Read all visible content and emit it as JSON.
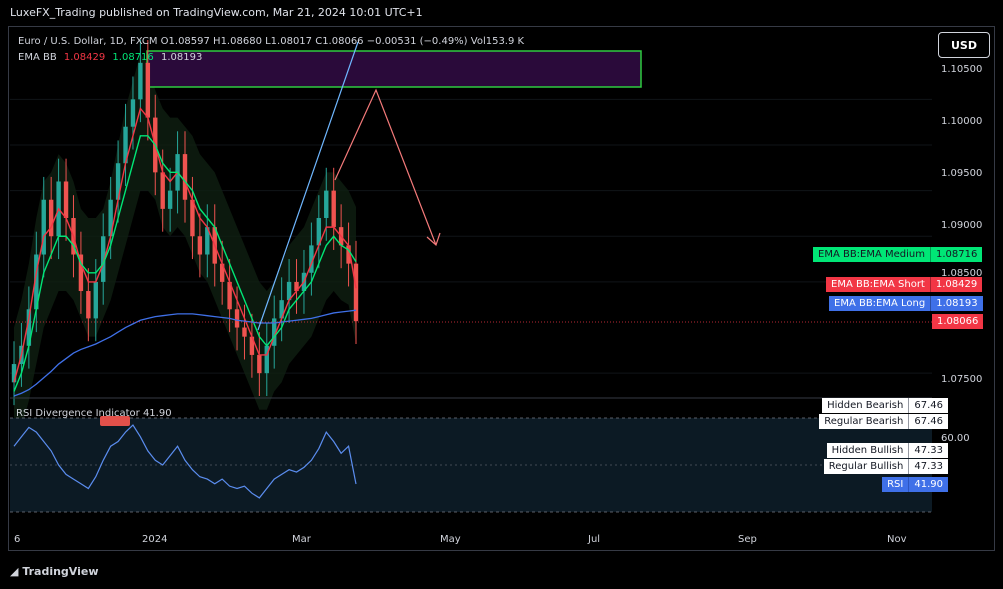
{
  "header": {
    "published": "LuxeFX_Trading published on TradingView.com, Mar 21, 2024 10:01 UTC+1",
    "symbol_line": "Euro / U.S. Dollar, 1D, FXCM  O1.08597  H1.08680  L1.08017  C1.08066  −0.00531 (−0.49%)  Vol153.9 K",
    "ema_label": "EMA BB",
    "ema_values": [
      "1.08429",
      "1.08716",
      "1.08193"
    ],
    "currency_button": "USD"
  },
  "colors": {
    "ema_short": "#f23645",
    "ema_medium": "#00e676",
    "ema_long": "#3f70e8",
    "bull": "#26a69a",
    "bear": "#ef5350",
    "rsi": "#5b8def",
    "zone": "#2a0a3a",
    "zone_border": "#2ecc40",
    "projection": "#f47a7a",
    "trendline": "#6fb7ff"
  },
  "price_tags": [
    {
      "name": "EMA BB:EMA Medium",
      "value": "1.08716",
      "bg": "#00e676",
      "fg": "#131722"
    },
    {
      "name": "EMA BB:EMA Short",
      "value": "1.08429",
      "bg": "#f23645",
      "fg": "#ffffff"
    },
    {
      "name": "EMA BB:EMA Long",
      "value": "1.08193",
      "bg": "#3f70e8",
      "fg": "#ffffff"
    },
    {
      "name": "",
      "value": "1.08066",
      "bg": "#f23645",
      "fg": "#ffffff"
    }
  ],
  "rsi": {
    "title": "RSI Divergence Indicator  41.90",
    "tags": [
      {
        "name": "Hidden Bearish",
        "value": "67.46"
      },
      {
        "name": "Regular Bearish",
        "value": "67.46"
      },
      {
        "name": "Hidden Bullish",
        "value": "47.33"
      },
      {
        "name": "Regular Bullish",
        "value": "47.33"
      },
      {
        "name": "RSI",
        "value": "41.90"
      }
    ],
    "level_label": "60.00"
  },
  "footer": {
    "brand": "TradingView"
  },
  "chart_data": {
    "type": "line",
    "y_ticks": [
      "1.10500",
      "1.10000",
      "1.09500",
      "1.09000",
      "1.08500",
      "1.07500"
    ],
    "x_ticks": [
      "6",
      "2024",
      "Mar",
      "May",
      "Jul",
      "Sep",
      "Nov"
    ],
    "ylim": [
      1.0725,
      1.1115
    ],
    "candles_close": [
      1.076,
      1.078,
      1.082,
      1.088,
      1.094,
      1.09,
      1.096,
      1.092,
      1.088,
      1.084,
      1.081,
      1.085,
      1.09,
      1.094,
      1.098,
      1.102,
      1.105,
      1.109,
      1.103,
      1.097,
      1.093,
      1.095,
      1.099,
      1.094,
      1.09,
      1.088,
      1.091,
      1.087,
      1.085,
      1.082,
      1.08,
      1.079,
      1.077,
      1.075,
      1.078,
      1.081,
      1.083,
      1.085,
      1.084,
      1.086,
      1.089,
      1.092,
      1.095,
      1.091,
      1.089,
      1.087,
      1.0807
    ],
    "series": [
      {
        "name": "EMA Short",
        "values": [
          1.074,
          1.077,
          1.081,
          1.086,
          1.09,
          1.091,
          1.093,
          1.092,
          1.09,
          1.087,
          1.085,
          1.085,
          1.087,
          1.09,
          1.094,
          1.098,
          1.101,
          1.104,
          1.103,
          1.1,
          1.097,
          1.096,
          1.097,
          1.096,
          1.094,
          1.092,
          1.091,
          1.089,
          1.087,
          1.085,
          1.083,
          1.081,
          1.079,
          1.077,
          1.077,
          1.079,
          1.081,
          1.083,
          1.084,
          1.085,
          1.087,
          1.089,
          1.091,
          1.091,
          1.09,
          1.089,
          1.0843
        ]
      },
      {
        "name": "EMA Medium",
        "values": [
          1.073,
          1.075,
          1.078,
          1.082,
          1.086,
          1.088,
          1.09,
          1.09,
          1.089,
          1.087,
          1.086,
          1.086,
          1.087,
          1.089,
          1.092,
          1.095,
          1.098,
          1.101,
          1.101,
          1.1,
          1.098,
          1.097,
          1.097,
          1.096,
          1.095,
          1.093,
          1.092,
          1.091,
          1.089,
          1.087,
          1.085,
          1.083,
          1.081,
          1.079,
          1.078,
          1.079,
          1.08,
          1.082,
          1.083,
          1.084,
          1.085,
          1.087,
          1.089,
          1.09,
          1.089,
          1.0885,
          1.0872
        ]
      },
      {
        "name": "EMA Long",
        "values": [
          1.0725,
          1.0728,
          1.0732,
          1.0738,
          1.0745,
          1.0752,
          1.076,
          1.0766,
          1.0772,
          1.0776,
          1.0779,
          1.0782,
          1.0786,
          1.079,
          1.0795,
          1.08,
          1.0804,
          1.0808,
          1.081,
          1.0812,
          1.0813,
          1.0814,
          1.0815,
          1.0815,
          1.0815,
          1.0814,
          1.0813,
          1.0812,
          1.0811,
          1.081,
          1.0808,
          1.0807,
          1.0806,
          1.0805,
          1.0805,
          1.0805,
          1.0806,
          1.0807,
          1.0808,
          1.0809,
          1.081,
          1.0812,
          1.0814,
          1.0816,
          1.0817,
          1.0818,
          1.0819
        ]
      },
      {
        "name": "RSI",
        "values": [
          58,
          62,
          66,
          64,
          60,
          56,
          50,
          46,
          44,
          42,
          40,
          45,
          52,
          58,
          60,
          64,
          67,
          62,
          56,
          52,
          50,
          54,
          58,
          52,
          48,
          45,
          44,
          42,
          44,
          41,
          40,
          41,
          38,
          36,
          40,
          44,
          46,
          48,
          47,
          49,
          52,
          57,
          64,
          60,
          55,
          58,
          41.9
        ]
      }
    ]
  }
}
